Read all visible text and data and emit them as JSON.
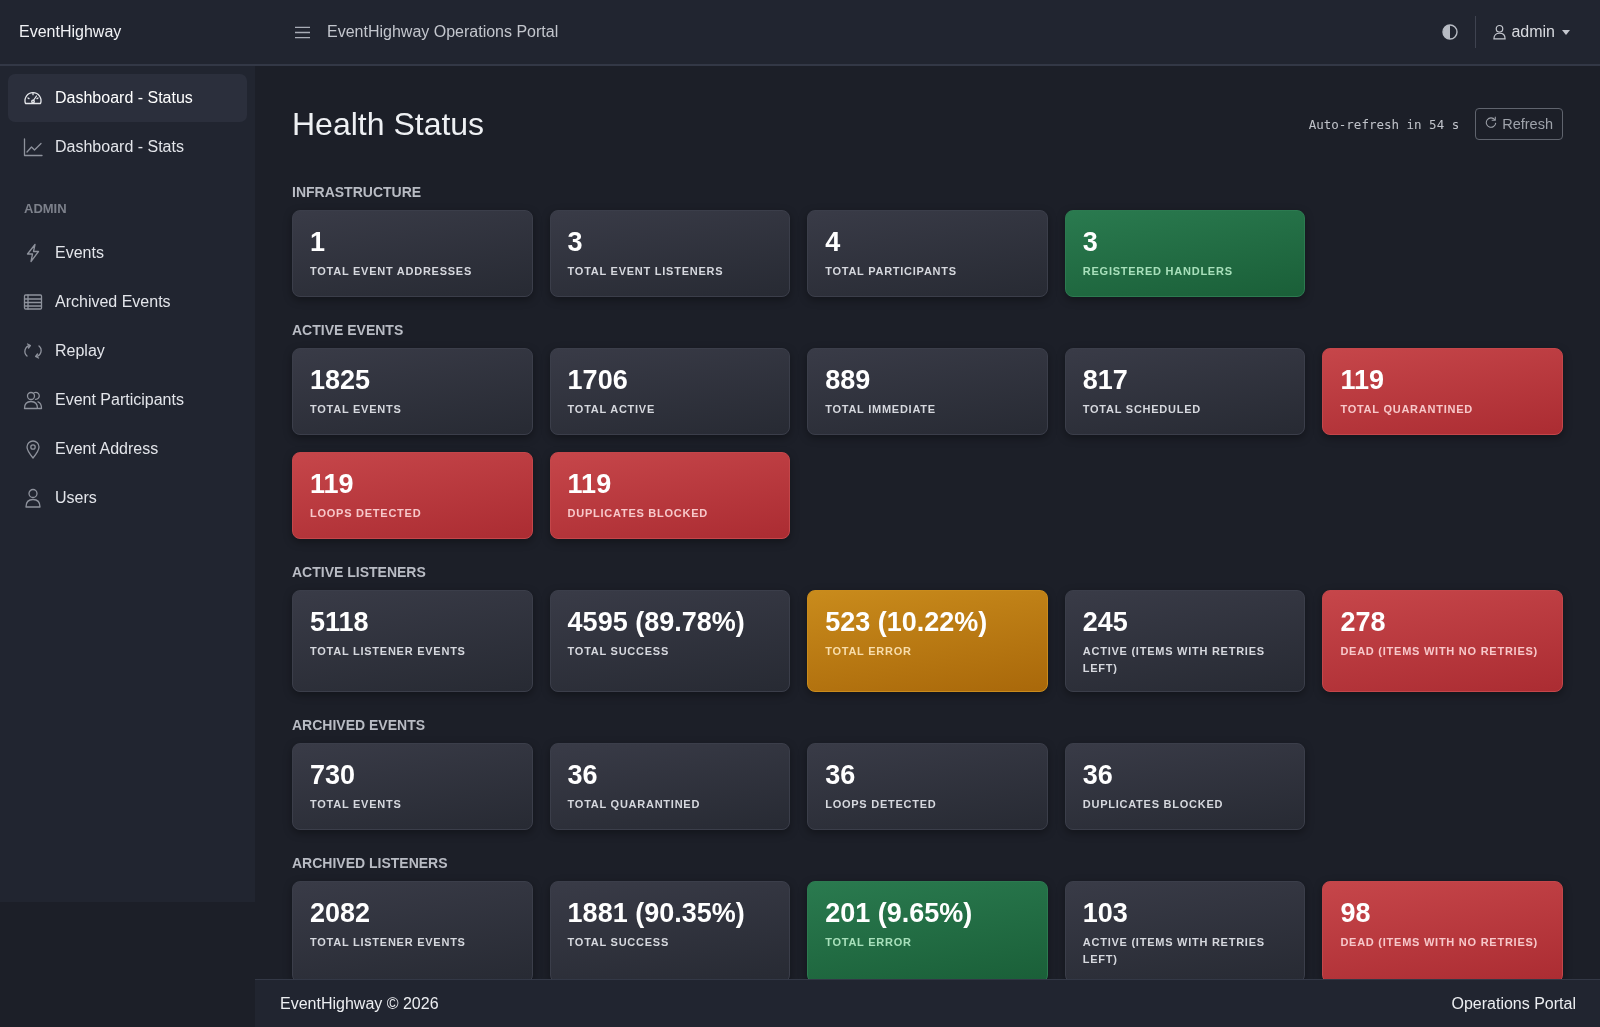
{
  "topbar": {
    "brand": "EventHighway",
    "title": "EventHighway Operations Portal",
    "user": "admin"
  },
  "sidebar": {
    "groups": [
      {
        "items": [
          {
            "label": "Dashboard - Status",
            "selected": true
          },
          {
            "label": "Dashboard - Stats",
            "selected": false
          }
        ]
      },
      {
        "heading": "ADMIN",
        "items": [
          {
            "label": "Events",
            "selected": false
          },
          {
            "label": "Archived Events",
            "selected": false
          },
          {
            "label": "Replay",
            "selected": false
          },
          {
            "label": "Event Participants",
            "selected": false
          },
          {
            "label": "Event Address",
            "selected": false
          },
          {
            "label": "Users",
            "selected": false
          }
        ]
      }
    ]
  },
  "page": {
    "title": "Health Status",
    "auto_refresh": "Auto-refresh in 54 s",
    "refresh_button": "Refresh"
  },
  "sections": [
    {
      "heading": "INFRASTRUCTURE",
      "cards": [
        {
          "value": "1",
          "label": "TOTAL EVENT ADDRESSES",
          "kind": "neutral"
        },
        {
          "value": "3",
          "label": "TOTAL EVENT LISTENERS",
          "kind": "neutral"
        },
        {
          "value": "4",
          "label": "TOTAL PARTICIPANTS",
          "kind": "neutral"
        },
        {
          "value": "3",
          "label": "REGISTERED HANDLERS",
          "kind": "success"
        }
      ]
    },
    {
      "heading": "ACTIVE EVENTS",
      "cards": [
        {
          "value": "1825",
          "label": "TOTAL EVENTS",
          "kind": "neutral"
        },
        {
          "value": "1706",
          "label": "TOTAL ACTIVE",
          "kind": "neutral"
        },
        {
          "value": "889",
          "label": "TOTAL IMMEDIATE",
          "kind": "neutral"
        },
        {
          "value": "817",
          "label": "TOTAL SCHEDULED",
          "kind": "neutral"
        },
        {
          "value": "119",
          "label": "TOTAL QUARANTINED",
          "kind": "danger"
        },
        {
          "value": "119",
          "label": "LOOPS DETECTED",
          "kind": "danger"
        },
        {
          "value": "119",
          "label": "DUPLICATES BLOCKED",
          "kind": "danger"
        }
      ]
    },
    {
      "heading": "ACTIVE LISTENERS",
      "cards": [
        {
          "value": "5118",
          "label": "TOTAL LISTENER EVENTS",
          "kind": "neutral"
        },
        {
          "value": "4595 (89.78%)",
          "label": "TOTAL SUCCESS",
          "kind": "neutral"
        },
        {
          "value": "523 (10.22%)",
          "label": "TOTAL ERROR",
          "kind": "warning"
        },
        {
          "value": "245",
          "label": "ACTIVE (ITEMS WITH RETRIES LEFT)",
          "kind": "neutral"
        },
        {
          "value": "278",
          "label": "DEAD (ITEMS WITH NO RETRIES)",
          "kind": "danger"
        }
      ]
    },
    {
      "heading": "ARCHIVED EVENTS",
      "cards": [
        {
          "value": "730",
          "label": "TOTAL EVENTS",
          "kind": "neutral"
        },
        {
          "value": "36",
          "label": "TOTAL QUARANTINED",
          "kind": "neutral"
        },
        {
          "value": "36",
          "label": "LOOPS DETECTED",
          "kind": "neutral"
        },
        {
          "value": "36",
          "label": "DUPLICATES BLOCKED",
          "kind": "neutral"
        }
      ]
    },
    {
      "heading": "ARCHIVED LISTENERS",
      "cards": [
        {
          "value": "2082",
          "label": "TOTAL LISTENER EVENTS",
          "kind": "neutral"
        },
        {
          "value": "1881 (90.35%)",
          "label": "TOTAL SUCCESS",
          "kind": "neutral"
        },
        {
          "value": "201 (9.65%)",
          "label": "TOTAL ERROR",
          "kind": "success"
        },
        {
          "value": "103",
          "label": "ACTIVE (ITEMS WITH RETRIES LEFT)",
          "kind": "neutral"
        },
        {
          "value": "98",
          "label": "DEAD (ITEMS WITH NO RETRIES)",
          "kind": "danger"
        }
      ]
    }
  ],
  "footer": {
    "left": "EventHighway © 2026",
    "right": "Operations Portal"
  }
}
